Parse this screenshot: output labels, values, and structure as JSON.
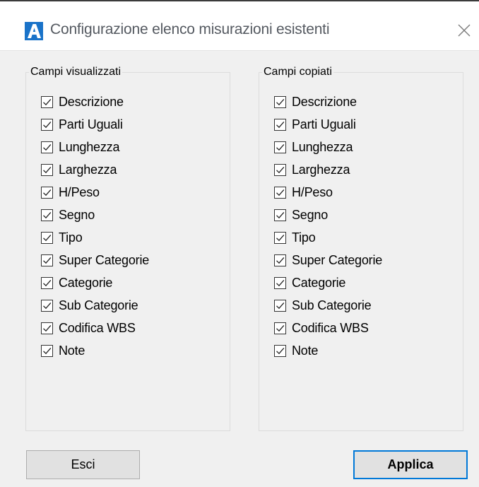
{
  "window": {
    "title": "Configurazione elenco misurazioni esistenti",
    "icon": "app-logo-a-icon",
    "close_icon": "close-icon",
    "accent": "#0078d7"
  },
  "left_group": {
    "title": "Campi visualizzati",
    "items": [
      {
        "label": "Descrizione",
        "checked": true
      },
      {
        "label": "Parti Uguali",
        "checked": true
      },
      {
        "label": "Lunghezza",
        "checked": true
      },
      {
        "label": "Larghezza",
        "checked": true
      },
      {
        "label": "H/Peso",
        "checked": true
      },
      {
        "label": "Segno",
        "checked": true
      },
      {
        "label": "Tipo",
        "checked": true
      },
      {
        "label": "Super Categorie",
        "checked": true
      },
      {
        "label": "Categorie",
        "checked": true
      },
      {
        "label": "Sub Categorie",
        "checked": true
      },
      {
        "label": "Codifica WBS",
        "checked": true
      },
      {
        "label": "Note",
        "checked": true
      }
    ]
  },
  "right_group": {
    "title": "Campi copiati",
    "items": [
      {
        "label": "Descrizione",
        "checked": true
      },
      {
        "label": "Parti Uguali",
        "checked": true
      },
      {
        "label": "Lunghezza",
        "checked": true
      },
      {
        "label": "Larghezza",
        "checked": true
      },
      {
        "label": "H/Peso",
        "checked": true
      },
      {
        "label": "Segno",
        "checked": true
      },
      {
        "label": "Tipo",
        "checked": true
      },
      {
        "label": "Super Categorie",
        "checked": true
      },
      {
        "label": "Categorie",
        "checked": true
      },
      {
        "label": "Sub Categorie",
        "checked": true
      },
      {
        "label": "Codifica WBS",
        "checked": true
      },
      {
        "label": "Note",
        "checked": true
      }
    ]
  },
  "buttons": {
    "esci": "Esci",
    "applica": "Applica"
  }
}
